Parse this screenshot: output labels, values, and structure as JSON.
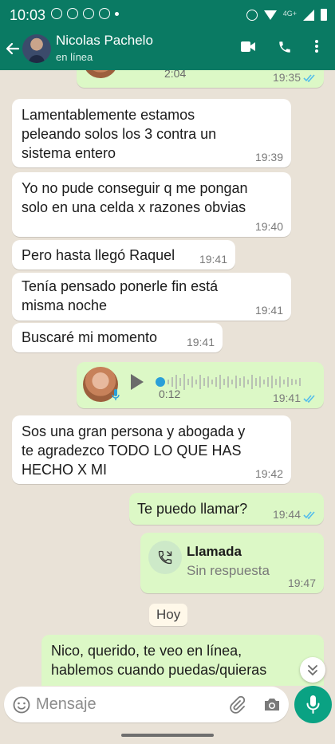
{
  "status_bar": {
    "time": "10:03",
    "network": "4G+"
  },
  "header": {
    "contact_name": "Nicolas Pachelo",
    "contact_status": "en línea"
  },
  "messages": [
    {
      "text": "2:04",
      "time": "19:35"
    },
    {
      "text": "Lamentablemente estamos\npeleando solos  los 3 contra un\nsistema entero",
      "time": "19:39"
    },
    {
      "text": "Yo no pude conseguir q me pongan\nsolo en una celda x razones obvias",
      "time": "19:40"
    },
    {
      "text": "Pero hasta llegó Raquel",
      "time": "19:41"
    },
    {
      "text": "Tenía pensado ponerle fin está\nmisma noche",
      "time": "19:41"
    },
    {
      "text": "Buscaré mi momento",
      "time": "19:41"
    },
    {
      "text": "0:12",
      "time": "19:41"
    },
    {
      "text": "Sos una gran persona y abogada y\nte agradezco TODO LO QUE HAS\nHECHO X MI",
      "time": "19:42"
    },
    {
      "text": "Te puedo llamar?",
      "time": "19:44"
    },
    {
      "title": "Llamada",
      "subtitle": "Sin respuesta",
      "time": "19:47"
    },
    {
      "text": "Nico, querido, te veo en línea,\nhablemos cuando puedas/quieras",
      "time": ""
    }
  ],
  "day_label": "Hoy",
  "input": {
    "placeholder": "Mensaje"
  },
  "colors": {
    "header": "#0a7a63",
    "outgoing": "#dcf8c6",
    "incoming": "#ffffff",
    "accent": "#0aa283",
    "read_tick": "#53bdeb"
  },
  "icons": [
    "back-arrow-icon",
    "video-call-icon",
    "phone-icon",
    "menu-dots-icon",
    "play-icon",
    "mic-icon",
    "missed-call-icon",
    "chevron-down-icon",
    "emoji-icon",
    "attach-icon",
    "camera-icon"
  ]
}
